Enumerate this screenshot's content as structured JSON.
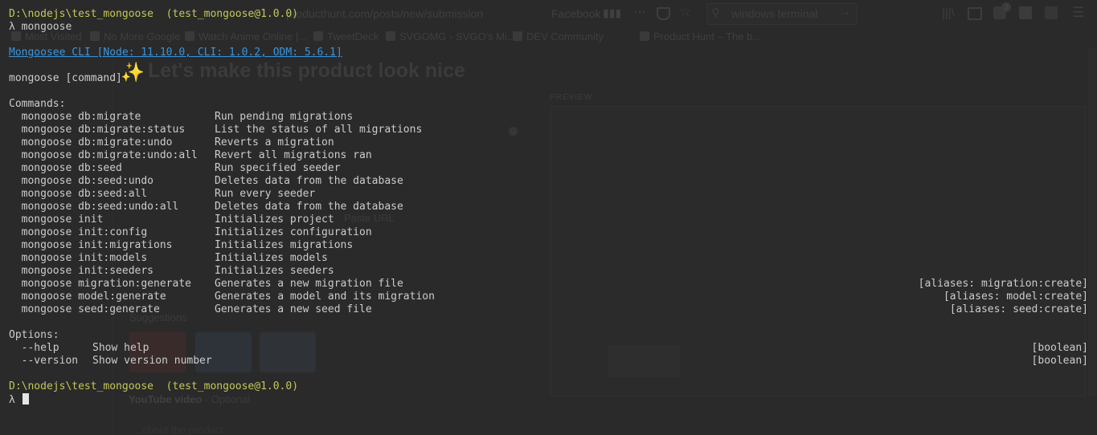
{
  "background_browser": {
    "url": "producthunt.com/posts/new/submission",
    "facebook_bookmark": "Facebook",
    "search_value": "windows terminal",
    "notification_count": "2",
    "bookmarks": [
      "Most Visited",
      "No More Google",
      "Watch Anime Online |...",
      "TweetDeck",
      "SVGOMG - SVGO's Mi...",
      "DEV Community",
      "Product Hunt – The b..."
    ],
    "heading": "Let's make this product look nice",
    "preview_label": "PREVIEW",
    "paste_url": "Paste URL",
    "suggestions_label": "Suggestions",
    "youtube_label": "YouTube video",
    "youtube_optional": " - Optional",
    "youtube_hint": "...about the product"
  },
  "terminal": {
    "prompt1": {
      "path": "D:\\nodejs\\test_mongoose",
      "package": "(test_mongoose@1.0.0)",
      "command": "λ mongoose"
    },
    "cli_banner": "Mongoosee CLI [Node: 11.10.0, CLI: 1.0.2, ODM: 5.6.1]",
    "usage": "mongoose [command]",
    "commands_header": "Commands:",
    "commands": [
      {
        "cmd": "  mongoose db:migrate",
        "desc": "Run pending migrations",
        "alias": ""
      },
      {
        "cmd": "  mongoose db:migrate:status",
        "desc": "List the status of all migrations",
        "alias": ""
      },
      {
        "cmd": "  mongoose db:migrate:undo",
        "desc": "Reverts a migration",
        "alias": ""
      },
      {
        "cmd": "  mongoose db:migrate:undo:all",
        "desc": "Revert all migrations ran",
        "alias": ""
      },
      {
        "cmd": "  mongoose db:seed",
        "desc": "Run specified seeder",
        "alias": ""
      },
      {
        "cmd": "  mongoose db:seed:undo",
        "desc": "Deletes data from the database",
        "alias": ""
      },
      {
        "cmd": "  mongoose db:seed:all",
        "desc": "Run every seeder",
        "alias": ""
      },
      {
        "cmd": "  mongoose db:seed:undo:all",
        "desc": "Deletes data from the database",
        "alias": ""
      },
      {
        "cmd": "  mongoose init",
        "desc": "Initializes project",
        "alias": ""
      },
      {
        "cmd": "  mongoose init:config",
        "desc": "Initializes configuration",
        "alias": ""
      },
      {
        "cmd": "  mongoose init:migrations",
        "desc": "Initializes migrations",
        "alias": ""
      },
      {
        "cmd": "  mongoose init:models",
        "desc": "Initializes models",
        "alias": ""
      },
      {
        "cmd": "  mongoose init:seeders",
        "desc": "Initializes seeders",
        "alias": ""
      },
      {
        "cmd": "  mongoose migration:generate",
        "desc": "Generates a new migration file",
        "alias": "[aliases: migration:create]"
      },
      {
        "cmd": "  mongoose model:generate",
        "desc": "Generates a model and its migration",
        "alias": "[aliases: model:create]"
      },
      {
        "cmd": "  mongoose seed:generate",
        "desc": "Generates a new seed file",
        "alias": "[aliases: seed:create]"
      }
    ],
    "options_header": "Options:",
    "options": [
      {
        "flag": "  --help",
        "desc": "Show help",
        "type": "[boolean]"
      },
      {
        "flag": "  --version",
        "desc": "Show version number",
        "type": "[boolean]"
      }
    ],
    "prompt2": {
      "path": "D:\\nodejs\\test_mongoose",
      "package": "(test_mongoose@1.0.0)",
      "lambda": "λ"
    }
  },
  "colors": {
    "background": "#2a2a2a",
    "text": "#cccccc",
    "prompt": "#c3c75a",
    "link": "#3a95dd",
    "cursor": "#e6e6e6"
  }
}
